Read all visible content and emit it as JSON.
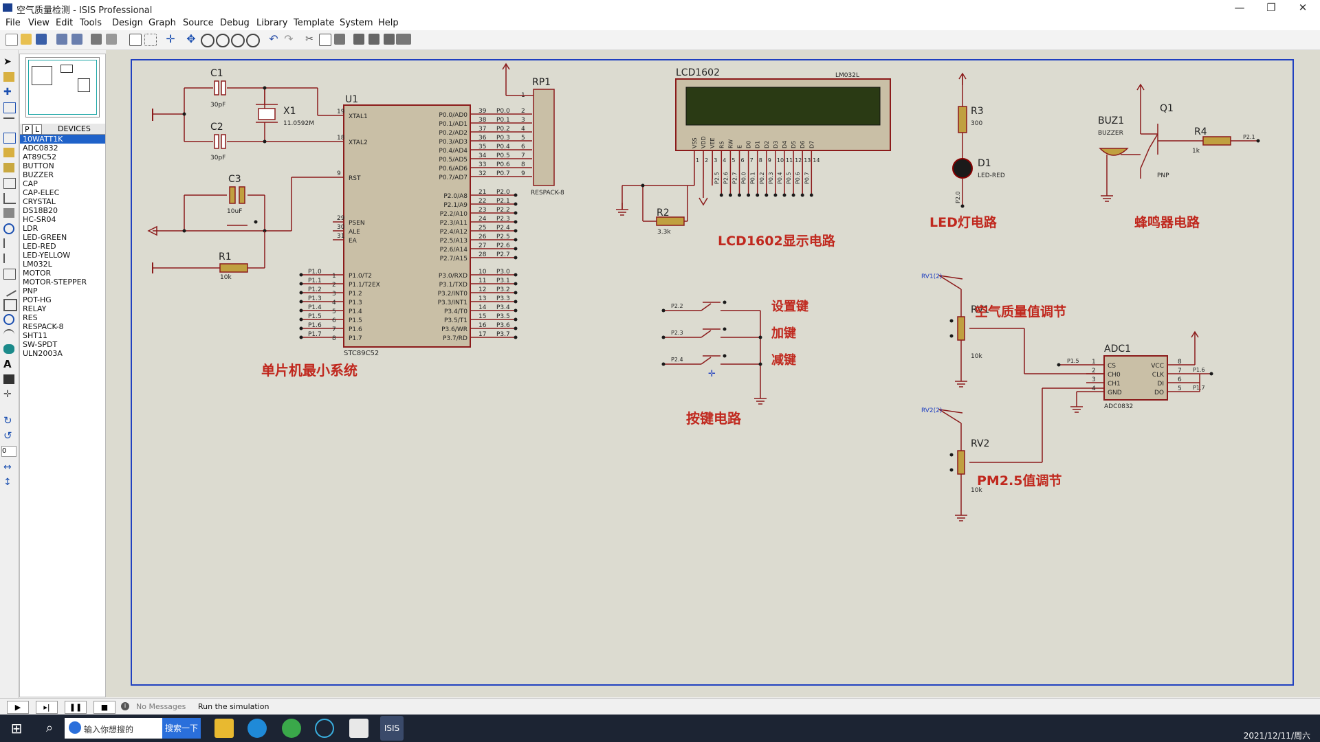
{
  "window": {
    "title": "空气质量检测 - ISIS Professional",
    "min": "—",
    "restore": "❐",
    "close": "✕"
  },
  "menu": [
    "File",
    "View",
    "Edit",
    "Tools",
    "Design",
    "Graph",
    "Source",
    "Debug",
    "Library",
    "Template",
    "System",
    "Help"
  ],
  "device_panel": {
    "tab_p": "P",
    "tab_l": "L",
    "tab_devices": "DEVICES",
    "items": [
      "10WATT1K",
      "ADC0832",
      "AT89C52",
      "BUTTON",
      "BUZZER",
      "CAP",
      "CAP-ELEC",
      "CRYSTAL",
      "DS18B20",
      "HC-SR04",
      "LDR",
      "LED-GREEN",
      "LED-RED",
      "LED-YELLOW",
      "LM032L",
      "MOTOR",
      "MOTOR-STEPPER",
      "PNP",
      "POT-HG",
      "RELAY",
      "RES",
      "RESPACK-8",
      "SHT11",
      "SW-SPDT",
      "ULN2003A"
    ],
    "selected_index": 0
  },
  "schematic": {
    "mcu": {
      "ref": "U1",
      "part": "STC89C52",
      "left_pins": [
        [
          "19",
          "XTAL1"
        ],
        [
          "18",
          "XTAL2"
        ],
        [
          "9",
          "RST"
        ],
        [
          "29",
          "PSEN"
        ],
        [
          "30",
          "ALE"
        ],
        [
          "31",
          "EA"
        ]
      ],
      "p1_pins": [
        [
          "1",
          "P1.0/T2",
          "P1.0"
        ],
        [
          "2",
          "P1.1/T2EX",
          "P1.1"
        ],
        [
          "3",
          "P1.2",
          "P1.2"
        ],
        [
          "4",
          "P1.3",
          "P1.3"
        ],
        [
          "5",
          "P1.4",
          "P1.4"
        ],
        [
          "6",
          "P1.5",
          "P1.5"
        ],
        [
          "7",
          "P1.6",
          "P1.6"
        ],
        [
          "8",
          "P1.7",
          "P1.7"
        ]
      ],
      "p0_pins": [
        [
          "39",
          "P0.0/AD0",
          "P0.0"
        ],
        [
          "38",
          "P0.1/AD1",
          "P0.1"
        ],
        [
          "37",
          "P0.2/AD2",
          "P0.2"
        ],
        [
          "36",
          "P0.3/AD3",
          "P0.3"
        ],
        [
          "35",
          "P0.4/AD4",
          "P0.4"
        ],
        [
          "34",
          "P0.5/AD5",
          "P0.5"
        ],
        [
          "33",
          "P0.6/AD6",
          "P0.6"
        ],
        [
          "32",
          "P0.7/AD7",
          "P0.7"
        ]
      ],
      "p2_pins": [
        [
          "21",
          "P2.0/A8",
          "P2.0"
        ],
        [
          "22",
          "P2.1/A9",
          "P2.1"
        ],
        [
          "23",
          "P2.2/A10",
          "P2.2"
        ],
        [
          "24",
          "P2.3/A11",
          "P2.3"
        ],
        [
          "25",
          "P2.4/A12",
          "P2.4"
        ],
        [
          "26",
          "P2.5/A13",
          "P2.5"
        ],
        [
          "27",
          "P2.6/A14",
          "P2.6"
        ],
        [
          "28",
          "P2.7/A15",
          "P2.7"
        ]
      ],
      "p3_pins": [
        [
          "10",
          "P3.0/RXD",
          "P3.0"
        ],
        [
          "11",
          "P3.1/TXD",
          "P3.1"
        ],
        [
          "12",
          "P3.2/INT0",
          "P3.2"
        ],
        [
          "13",
          "P3.3/INT1",
          "P3.3"
        ],
        [
          "14",
          "P3.4/T0",
          "P3.4"
        ],
        [
          "15",
          "P3.5/T1",
          "P3.5"
        ],
        [
          "16",
          "P3.6/WR",
          "P3.6"
        ],
        [
          "17",
          "P3.7/RD",
          "P3.7"
        ]
      ]
    },
    "c1": {
      "ref": "C1",
      "val": "30pF"
    },
    "c2": {
      "ref": "C2",
      "val": "30pF"
    },
    "c3": {
      "ref": "C3",
      "val": "10uF"
    },
    "x1": {
      "ref": "X1",
      "val": "11.0592M"
    },
    "r1": {
      "ref": "R1",
      "val": "10k"
    },
    "rp1": {
      "ref": "RP1",
      "part": "RESPACK-8",
      "pin1": "1",
      "pins": [
        "2",
        "3",
        "4",
        "5",
        "6",
        "7",
        "8",
        "9"
      ]
    },
    "lcd": {
      "ref": "LCD1602",
      "part": "LM032L",
      "pins": [
        "VSS",
        "VDD",
        "VEE",
        "RS",
        "RW",
        "E",
        "D0",
        "D1",
        "D2",
        "D3",
        "D4",
        "D5",
        "D6",
        "D7"
      ],
      "pin_nums": [
        "1",
        "2",
        "3",
        "4",
        "5",
        "6",
        "7",
        "8",
        "9",
        "10",
        "11",
        "12",
        "13",
        "14"
      ],
      "nets": [
        "P2.5",
        "P2.6",
        "P2.7",
        "P0.0",
        "P0.1",
        "P0.2",
        "P0.3",
        "P0.4",
        "P0.5",
        "P0.6",
        "P0.7"
      ]
    },
    "r2": {
      "ref": "R2",
      "val": "3.3k"
    },
    "r3": {
      "ref": "R3",
      "val": "300"
    },
    "d1": {
      "ref": "D1",
      "part": "LED-RED",
      "net": "P2.0"
    },
    "buz": {
      "ref": "BUZ1",
      "part": "BUZZER"
    },
    "q1": {
      "ref": "Q1",
      "part": "PNP"
    },
    "r4": {
      "ref": "R4",
      "val": "1k",
      "net": "P2.1"
    },
    "keys": {
      "nets": [
        "P2.2",
        "P2.3",
        "P2.4"
      ],
      "labels": [
        "设置键",
        "加键",
        "减键"
      ]
    },
    "rv1": {
      "ref": "RV1",
      "val": "10k",
      "probe": "RV1(2)"
    },
    "rv2": {
      "ref": "RV2",
      "val": "10k",
      "probe": "RV2(2)"
    },
    "adc": {
      "ref": "ADC1",
      "part": "ADC0832",
      "left": [
        [
          "1",
          "CS"
        ],
        [
          "2",
          "CH0"
        ],
        [
          "3",
          "CH1"
        ],
        [
          "4",
          "GND"
        ]
      ],
      "right": [
        [
          "8",
          "VCC"
        ],
        [
          "7",
          "CLK"
        ],
        [
          "6",
          "DI"
        ],
        [
          "5",
          "DO"
        ]
      ],
      "nets": {
        "cs": "P1.5",
        "clk": "P1.6",
        "do": "P1.7"
      }
    },
    "section_labels": {
      "mcu": "单片机最小系统",
      "lcd": "LCD1602显示电路",
      "led": "LED灯电路",
      "buzzer": "蜂鸣器电路",
      "keys": "按键电路",
      "air": "空气质量值调节",
      "pm": "PM2.5值调节"
    }
  },
  "status": {
    "messages": "No Messages",
    "hint": "Run the simulation",
    "angle": "0"
  },
  "taskbar": {
    "search_placeholder": "输入你想搜的",
    "search_button": "搜索一下",
    "isis_label": "ISIS",
    "clock": "2021/12/11/周六"
  },
  "colors": {
    "wire": "#8b1a1a",
    "label": "#c0281e",
    "sheet_border": "#2040c0",
    "canvas": "#dcdbd0",
    "lcd_screen": "#2a3a14",
    "selection": "#1f62c9"
  }
}
